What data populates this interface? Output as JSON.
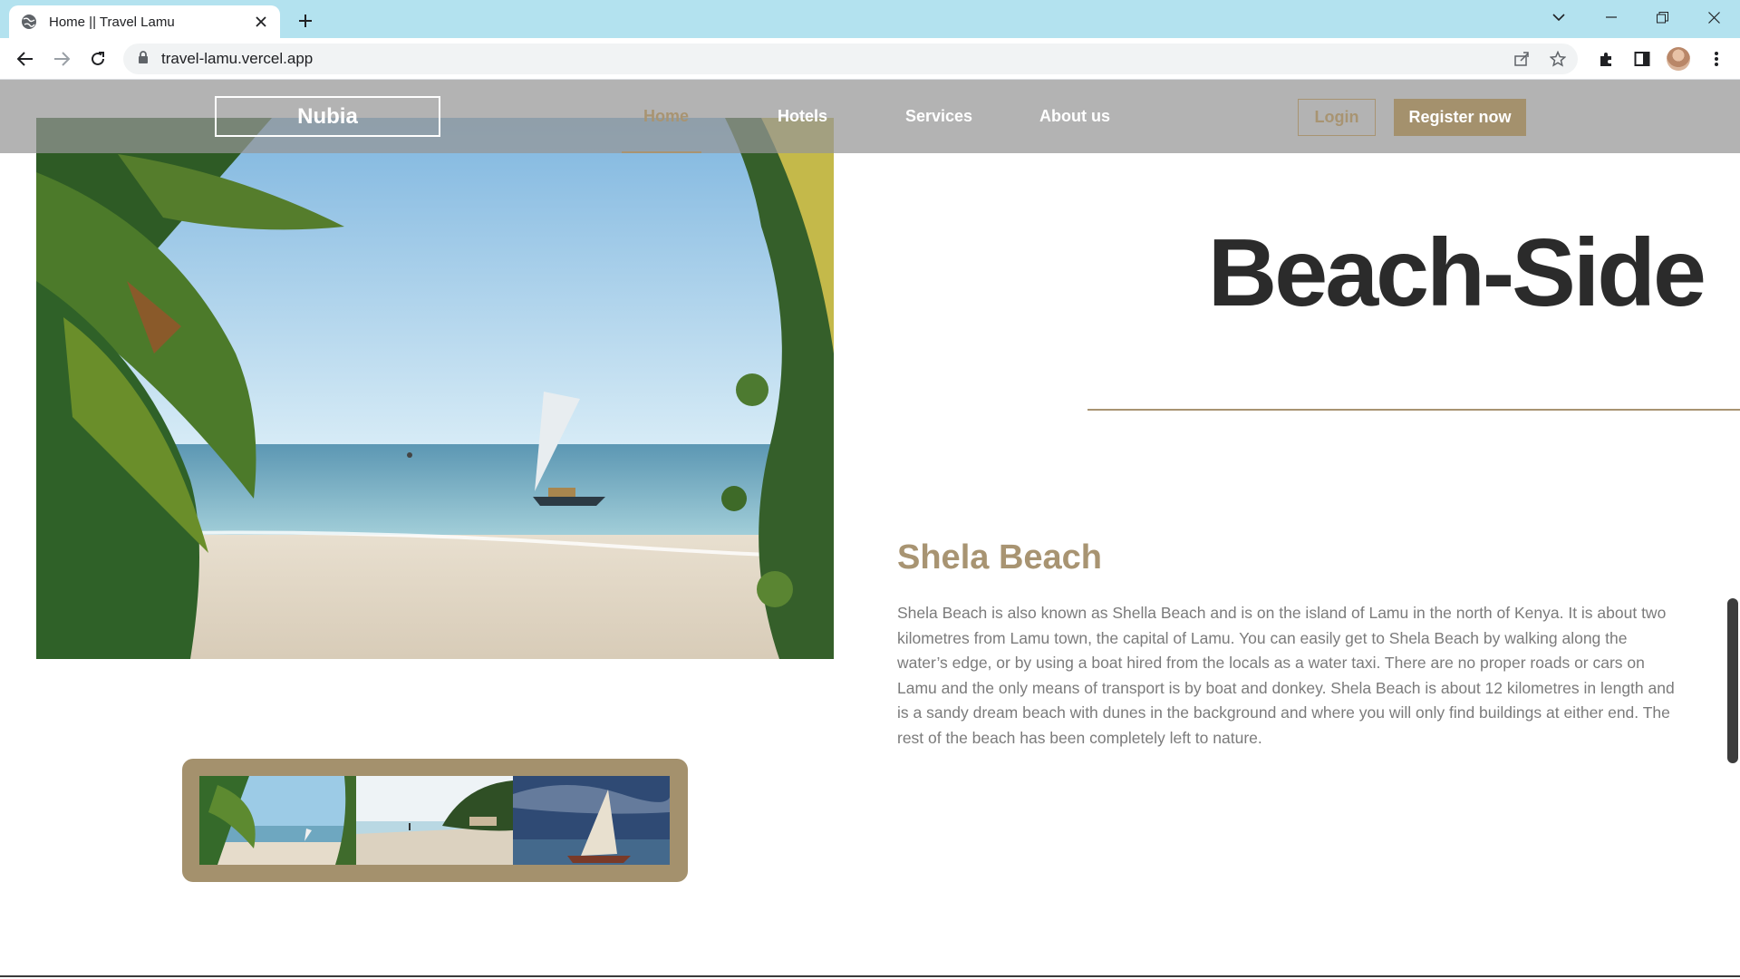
{
  "browser": {
    "tab_title": "Home || Travel Lamu",
    "url": "travel-lamu.vercel.app"
  },
  "site": {
    "logo": "Nubia",
    "nav": [
      "Home",
      "Hotels",
      "Services",
      "About us"
    ],
    "active_nav": "Home",
    "login_label": "Login",
    "register_label": "Register now"
  },
  "hero": {
    "title": "Beach-Side"
  },
  "section": {
    "title": "Shela Beach",
    "body": "Shela Beach is also known as Shella Beach and is on the island of Lamu in the north of Kenya. It is about two kilometres from Lamu town, the capital of Lamu. You can easily get to Shela Beach by walking along the water’s edge, or by using a boat hired from the locals as a water taxi. There are no proper roads or cars on Lamu and the only means of transport is by boat and donkey. Shela Beach is about 12 kilometres in length and is a sandy dream beach with dunes in the background and where you will only find buildings at either end. The rest of the beach has been completely left to nature."
  },
  "colors": {
    "accent": "#a89472",
    "tabbar": "#b3e2ef",
    "heading": "#2b2b2b",
    "body_text": "#7b7b7b"
  },
  "icons": [
    "globe-icon",
    "close-icon",
    "plus-icon",
    "chevron-down-icon",
    "minimize-icon",
    "restore-icon",
    "back-arrow-icon",
    "forward-arrow-icon",
    "reload-icon",
    "lock-icon",
    "share-icon",
    "star-icon",
    "extensions-icon",
    "side-panel-icon",
    "kebab-menu-icon"
  ]
}
